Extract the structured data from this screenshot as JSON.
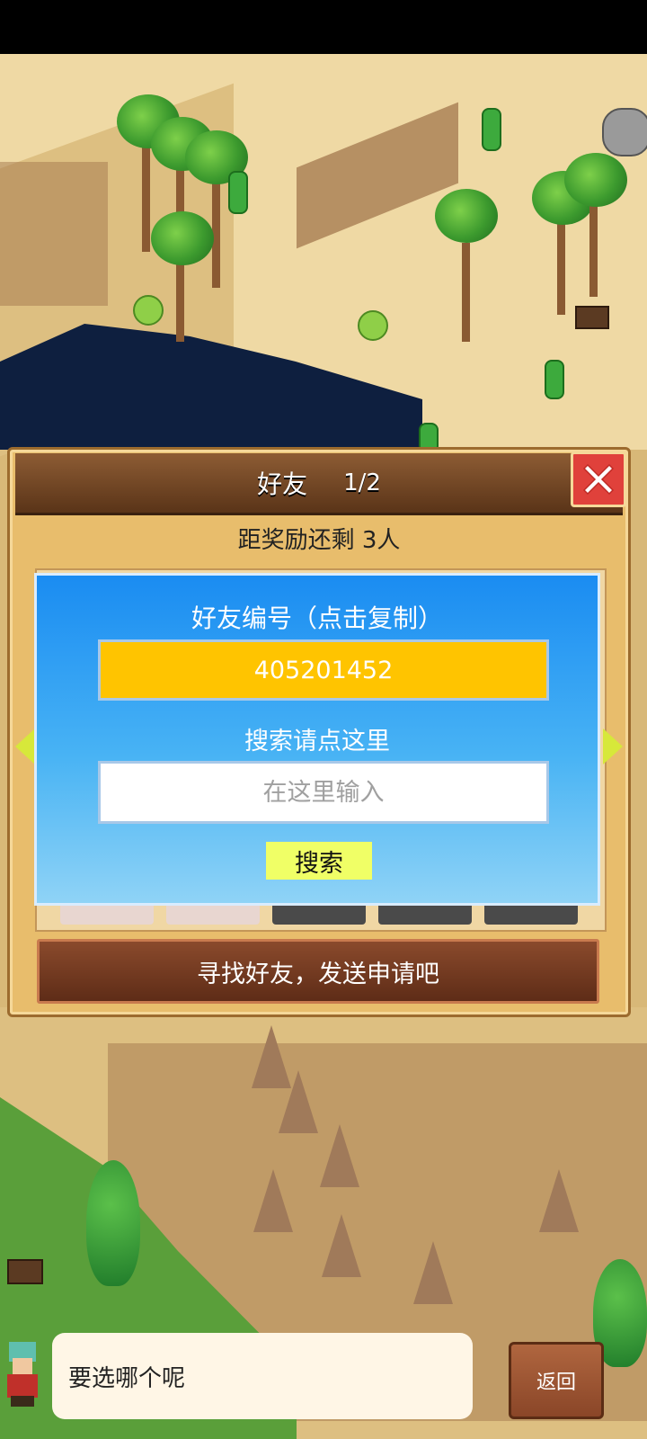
{
  "panel": {
    "title": "好友",
    "page_indicator": "1/2",
    "reward_text": "距奖励还剩 3人",
    "find_button_label": "寻找好友，发送申请吧"
  },
  "dialog": {
    "title": "好友编号（点击复制）",
    "friend_id": "405201452",
    "search_label": "搜索请点这里",
    "search_placeholder": "在这里输入",
    "search_button_label": "搜索"
  },
  "bottom": {
    "speech_text": "要选哪个呢",
    "back_button_label": "返回"
  },
  "colors": {
    "dialog_blue": "#1a8cf2",
    "id_box_yellow": "#ffc400",
    "search_button": "#f0ff66",
    "close_red": "#e0413b"
  },
  "icons": {
    "close": "close-icon",
    "prev": "arrow-left-icon",
    "next": "arrow-right-icon"
  }
}
